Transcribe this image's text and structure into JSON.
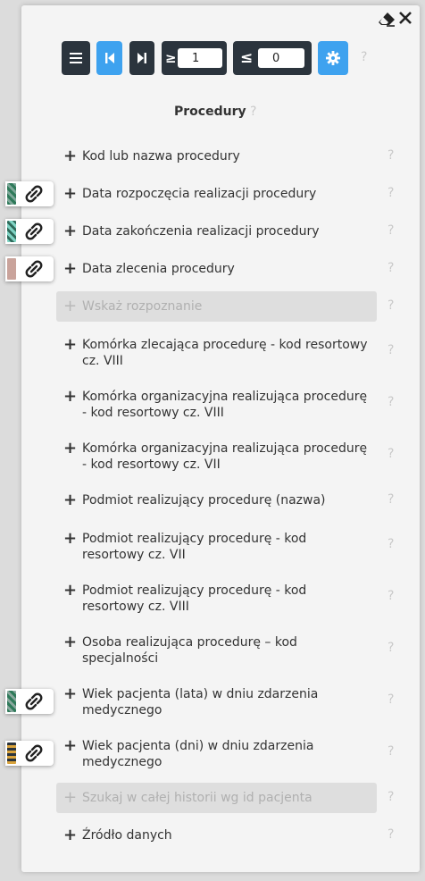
{
  "toolbar": {
    "ge_symbol": "≥",
    "ge_value": "1",
    "le_symbol": "≤",
    "le_value": "0",
    "help": "?"
  },
  "section": {
    "title": "Procedury",
    "help": "?"
  },
  "plus_glyph": "+",
  "help_glyph": "?",
  "items": [
    {
      "label": "Kod lub nazwa procedury",
      "disabled": false
    },
    {
      "label": "Data rozpoczęcia realizacji procedury",
      "disabled": false
    },
    {
      "label": "Data zakończenia realizacji procedury",
      "disabled": false
    },
    {
      "label": "Data zlecenia procedury",
      "disabled": false
    },
    {
      "label": "Wskaż rozpoznanie",
      "disabled": true
    },
    {
      "label": "Komórka zlecająca procedurę - kod resortowy cz. VIII",
      "disabled": false
    },
    {
      "label": "Komórka organizacyjna realizująca procedurę - kod resortowy cz. VIII",
      "disabled": false
    },
    {
      "label": "Komórka organizacyjna realizująca procedurę - kod resortowy cz. VII",
      "disabled": false
    },
    {
      "label": "Podmiot realizujący procedurę (nazwa)",
      "disabled": false
    },
    {
      "label": "Podmiot realizujący procedurę - kod resortowy cz. VII",
      "disabled": false
    },
    {
      "label": "Podmiot realizujący procedurę - kod resortowy cz. VIII",
      "disabled": false
    },
    {
      "label": "Osoba realizująca procedurę – kod specjalności",
      "disabled": false
    },
    {
      "label": "Wiek pacjenta (lata) w dniu zdarzenia medycznego",
      "disabled": false
    },
    {
      "label": "Wiek pacjenta (dni) w dniu zdarzenia medycznego",
      "disabled": false
    },
    {
      "label": "Szukaj w całej historii wg id pacjenta",
      "disabled": true
    },
    {
      "label": "Źródło danych",
      "disabled": false
    }
  ],
  "colors": {
    "dark_button": "#2b343d",
    "accent_blue": "#3ea2ef",
    "link_swatch_1": "#2f7a5a",
    "link_swatch_2": "#7fd3c4",
    "link_swatch_3": "#c9a39b",
    "link_swatch_4": "#2f7a5a",
    "link_swatch_5": "#d9a33c"
  }
}
